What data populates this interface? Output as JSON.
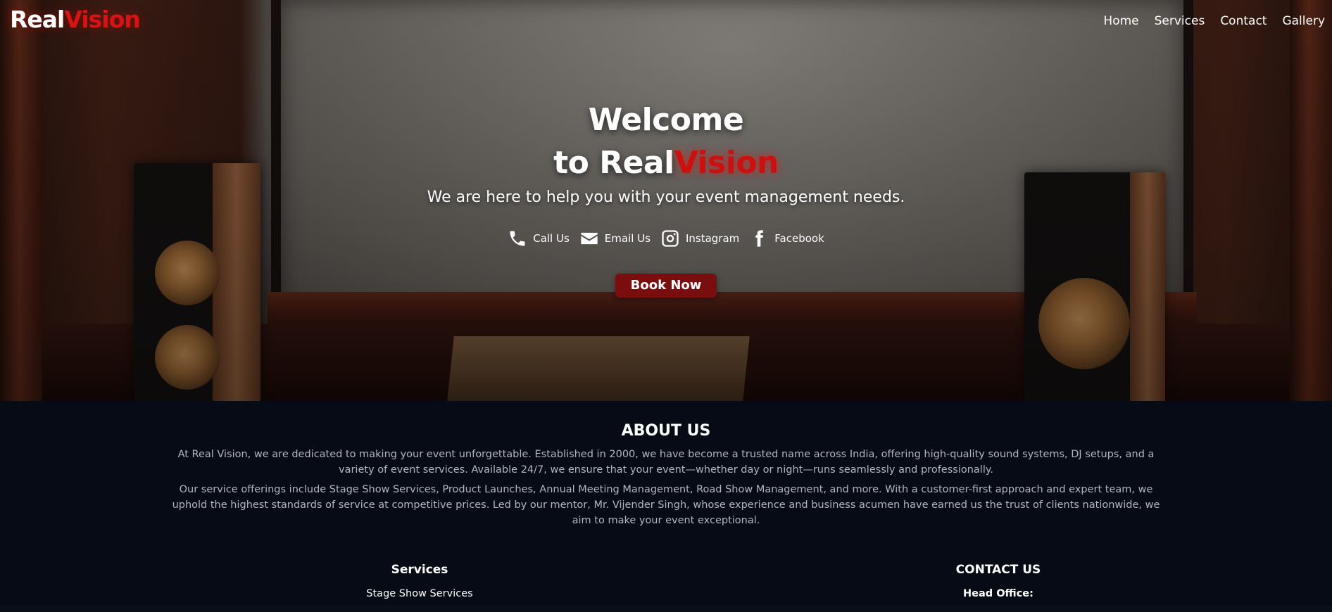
{
  "brand": {
    "part1": "Real",
    "part2": "Vision"
  },
  "nav": {
    "items": [
      "Home",
      "Services",
      "Contact",
      "Gallery"
    ]
  },
  "hero": {
    "line1": "Welcome",
    "line2_prefix": "to Real",
    "line2_accent": "Vision",
    "subtitle": "We are here to help you with your event management needs.",
    "contacts": [
      {
        "label": "Call Us",
        "icon": "phone-icon"
      },
      {
        "label": "Email Us",
        "icon": "envelope-icon"
      },
      {
        "label": "Instagram",
        "icon": "instagram-icon"
      },
      {
        "label": "Facebook",
        "icon": "facebook-icon"
      }
    ],
    "cta": "Book Now"
  },
  "about": {
    "title": "ABOUT US",
    "paragraph1": "At Real Vision, we are dedicated to making your event unforgettable. Established in 2000, we have become a trusted name across India, offering high-quality sound systems, DJ setups, and a variety of event services. Available 24/7, we ensure that your event—whether day or night—runs seamlessly and professionally.",
    "paragraph2": "Our service offerings include Stage Show Services, Product Launches, Annual Meeting Management, Road Show Management, and more. With a customer-first approach and expert team, we uphold the highest standards of service at competitive prices. Led by our mentor, Mr. Vijender Singh, whose experience and business acumen have earned us the trust of clients nationwide, we aim to make your event exceptional."
  },
  "footer": {
    "services_title": "Services",
    "services_first": "Stage Show Services",
    "contact_title": "CONTACT US",
    "head_office_label": "Head Office:"
  },
  "colors": {
    "accent": "#cc1010",
    "button": "#7a0d0d",
    "footer_bg": "#060b16"
  }
}
